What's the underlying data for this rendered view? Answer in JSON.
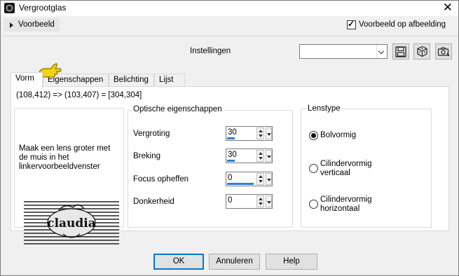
{
  "window": {
    "title": "Vergrootglas",
    "close_glyph": "✕"
  },
  "preview": {
    "toggle_label": "Voorbeeld",
    "checkbox_label": "Voorbeeld op afbeelding",
    "checked": true
  },
  "presets": {
    "label": "Instellingen",
    "value": ""
  },
  "tabs": [
    {
      "label": "Vorm",
      "active": true
    },
    {
      "label": "Eigenschappen"
    },
    {
      "label": "Belichting"
    },
    {
      "label": "Lijst"
    }
  ],
  "coords": "(108,412) => (103,407) = [304,304]",
  "info_text": "Maak een lens groter met de muis in het linkervoorbeeldvenster",
  "optical": {
    "title": "Optische eigenschappen",
    "fields": [
      {
        "label": "Vergroting",
        "value": "30",
        "level": 0.3
      },
      {
        "label": "Breking",
        "value": "30",
        "level": 0.3
      },
      {
        "label": "Focus opheffen",
        "value": "0",
        "level": 1.0
      },
      {
        "label": "Donkerheid",
        "value": "0",
        "level": 0.0
      }
    ]
  },
  "lens": {
    "title": "Lenstype",
    "options": [
      {
        "label": "Bolvormig",
        "checked": true
      },
      {
        "label_line1": "Cilindervormig",
        "label_line2": "verticaal",
        "checked": false
      },
      {
        "label_line1": "Cilindervormig",
        "label_line2": "horizontaal",
        "checked": false
      }
    ]
  },
  "buttons": {
    "ok": "OK",
    "cancel": "Annuleren",
    "help": "Help"
  },
  "watermark": {
    "text": "claudia"
  },
  "colors": {
    "accent": "#0078d7",
    "slider_fill": "#2f7fd4"
  }
}
